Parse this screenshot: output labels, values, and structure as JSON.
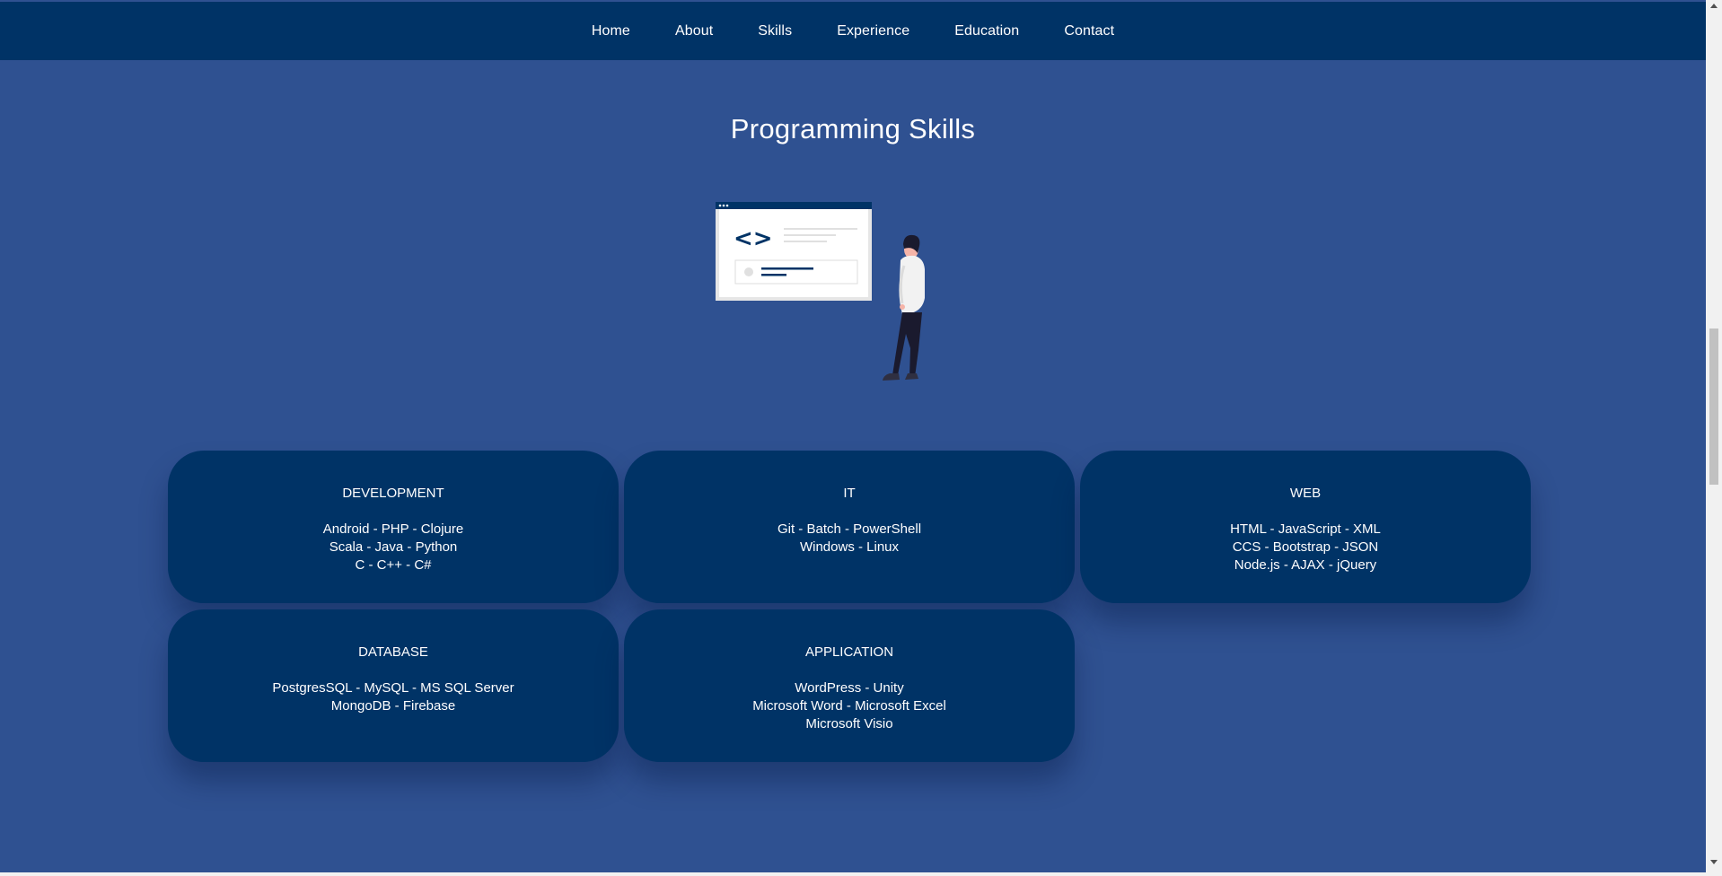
{
  "nav": {
    "items": [
      "Home",
      "About",
      "Skills",
      "Experience",
      "Education",
      "Contact"
    ]
  },
  "section": {
    "title": "Programming Skills"
  },
  "illustration": {
    "icon": "developer-at-code-window-illustration",
    "code_symbol": "<>"
  },
  "cards": [
    {
      "title": "DEVELOPMENT",
      "lines": [
        "Android - PHP - Clojure",
        "Scala - Java - Python",
        "C - C++ - C#"
      ]
    },
    {
      "title": "IT",
      "lines": [
        "Git - Batch - PowerShell",
        "Windows - Linux"
      ]
    },
    {
      "title": "WEB",
      "lines": [
        "HTML - JavaScript - XML",
        "CCS - Bootstrap - JSON",
        "Node.js - AJAX - jQuery"
      ]
    },
    {
      "title": "DATABASE",
      "lines": [
        "PostgresSQL - MySQL - MS SQL Server",
        "MongoDB - Firebase"
      ]
    },
    {
      "title": "APPLICATION",
      "lines": [
        "WordPress - Unity",
        "Microsoft Word - Microsoft Excel",
        "Microsoft Visio"
      ]
    }
  ],
  "colors": {
    "background": "#2f5191",
    "navbar": "#003366",
    "card": "#003366",
    "text": "#ffffff"
  }
}
